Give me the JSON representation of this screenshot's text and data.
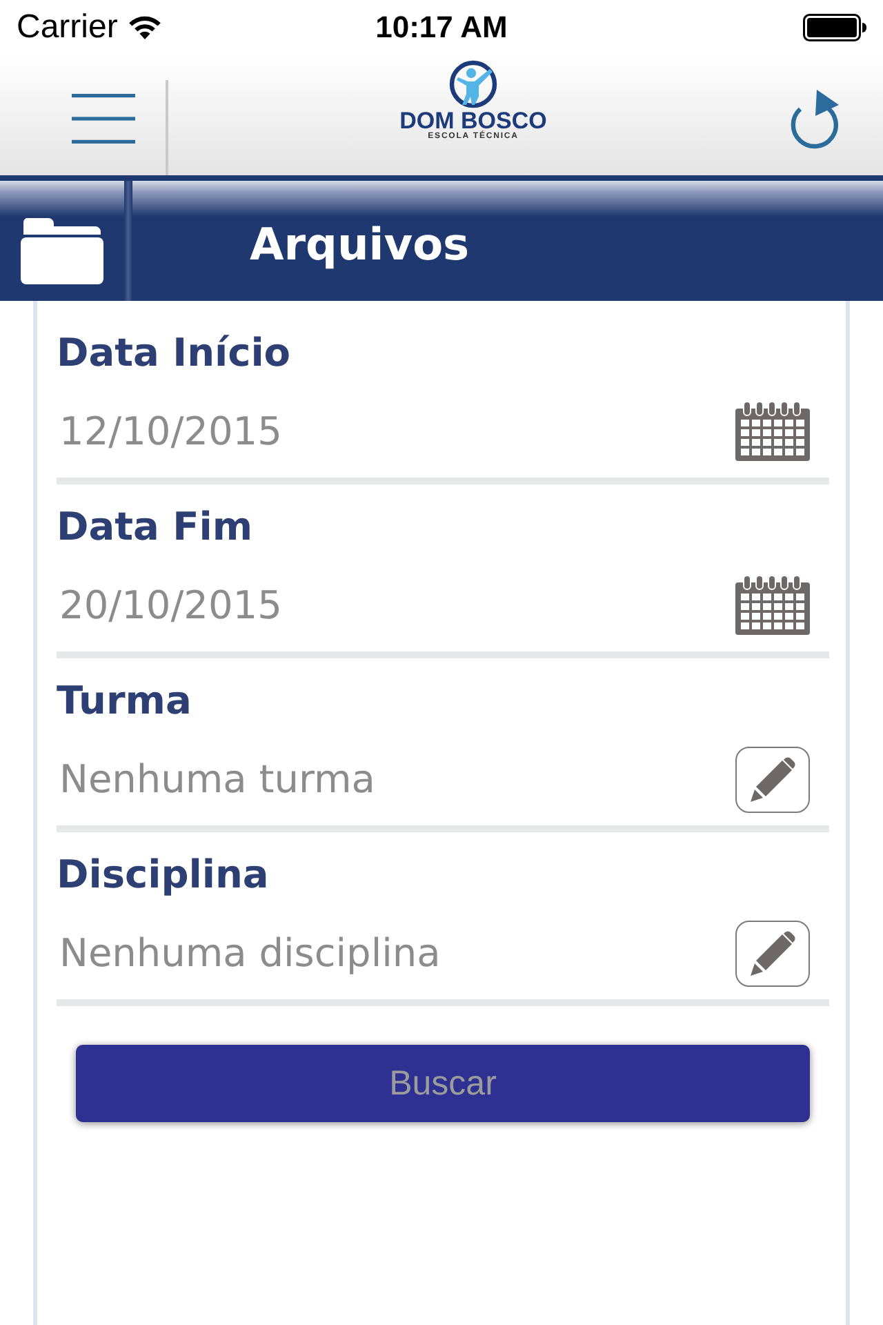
{
  "status_bar": {
    "carrier": "Carrier",
    "time": "10:17 AM"
  },
  "nav_bar": {
    "logo": {
      "name": "DOM BOSCO",
      "tagline": "ESCOLA TÉCNICA"
    }
  },
  "header": {
    "title": "Arquivos"
  },
  "fields": [
    {
      "kind": "date",
      "label": "Data Início",
      "value": "12/10/2015"
    },
    {
      "kind": "date",
      "label": "Data Fim",
      "value": "20/10/2015"
    },
    {
      "kind": "picker",
      "label": "Turma",
      "value": "Nenhuma turma"
    },
    {
      "kind": "picker",
      "label": "Disciplina",
      "value": "Nenhuma disciplina"
    }
  ],
  "search_button": {
    "label": "Buscar",
    "disabled": true
  }
}
